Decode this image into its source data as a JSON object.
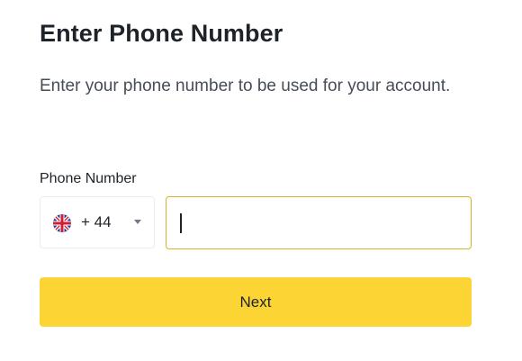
{
  "header": {
    "title": "Enter Phone Number",
    "subtitle": "Enter your phone number to be used for your account."
  },
  "phone": {
    "label": "Phone Number",
    "country": {
      "flag_icon": "uk-flag-icon",
      "dial_code": "+ 44",
      "chevron_icon": "chevron-down-icon"
    },
    "input": {
      "value": "",
      "placeholder": ""
    }
  },
  "actions": {
    "next_label": "Next"
  },
  "colors": {
    "primary_button": "#fcd535",
    "focus_border": "#d8b42a",
    "text_primary": "#1e2329",
    "text_secondary": "#474d57"
  }
}
